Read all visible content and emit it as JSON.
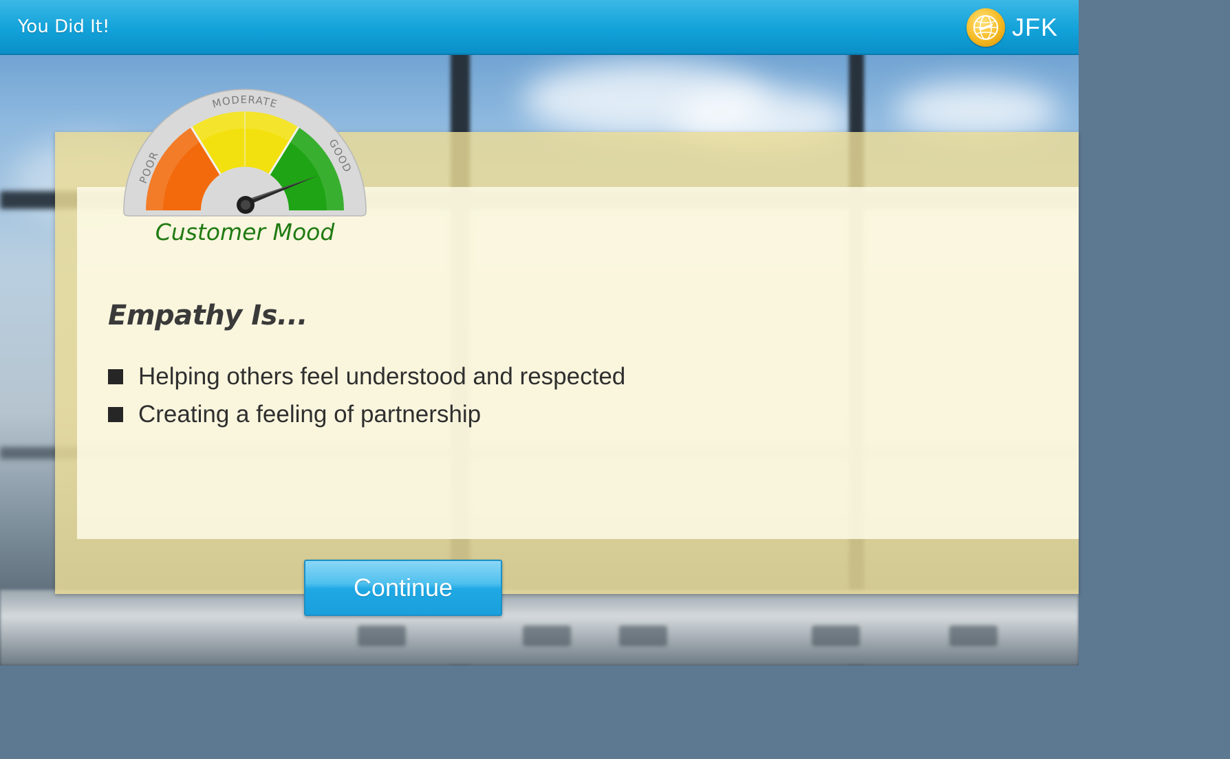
{
  "window": {
    "title": "You Did It!"
  },
  "brand": {
    "name": "JFK",
    "accent": "#f5b921"
  },
  "gauge": {
    "caption": "Customer Mood",
    "zones": [
      "POOR",
      "MODERATE",
      "GOOD"
    ],
    "zone_colors": [
      "#f26a0c",
      "#f3e10f",
      "#1ea414"
    ],
    "reading": "GOOD"
  },
  "content": {
    "heading": "Empathy Is...",
    "bullets": [
      "Helping others feel understood and respected",
      "Creating a feeling of partnership"
    ]
  },
  "actions": {
    "continue_label": "Continue",
    "accent": "#1fa8e4"
  }
}
